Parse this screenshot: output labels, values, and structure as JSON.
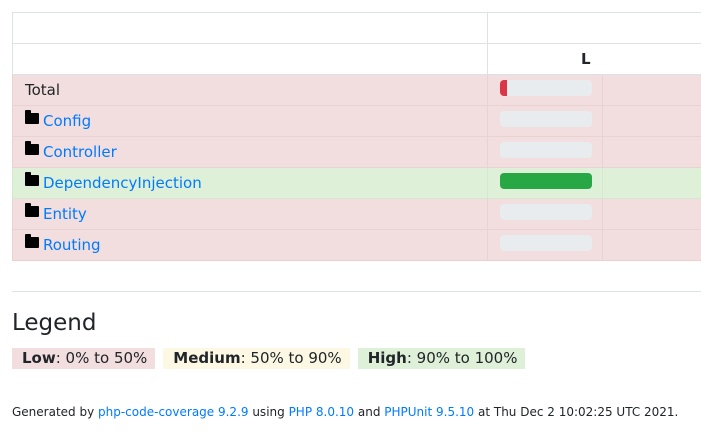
{
  "table": {
    "header_fragment": "L",
    "rows": [
      {
        "name": "Total",
        "type": "total",
        "level": "low",
        "coverage_percent": 8
      },
      {
        "name": "Config",
        "type": "directory",
        "level": "low",
        "coverage_percent": 0
      },
      {
        "name": "Controller",
        "type": "directory",
        "level": "low",
        "coverage_percent": 0
      },
      {
        "name": "DependencyInjection",
        "type": "directory",
        "level": "high",
        "coverage_percent": 100
      },
      {
        "name": "Entity",
        "type": "directory",
        "level": "low",
        "coverage_percent": 0
      },
      {
        "name": "Routing",
        "type": "directory",
        "level": "low",
        "coverage_percent": 0
      }
    ]
  },
  "legend": {
    "title": "Legend",
    "low": {
      "label": "Low",
      "range": ": 0% to 50%"
    },
    "medium": {
      "label": "Medium",
      "range": ": 50% to 90%"
    },
    "high": {
      "label": "High",
      "range": ": 90% to 100%"
    }
  },
  "footer": {
    "generated_by": "Generated by ",
    "tool_link": "php-code-coverage 9.2.9",
    "using": " using ",
    "php_link": "PHP 8.0.10",
    "and": " and ",
    "phpunit_link": "PHPUnit 9.5.10",
    "date": " at Thu Dec 2 10:02:25 UTC 2021."
  },
  "colors": {
    "low_bg": "#f2dede",
    "medium_bg": "#fcf8e3",
    "high_bg": "#dff0d8",
    "bar_danger": "#dc3545",
    "bar_success": "#28a745",
    "link": "#007bff"
  },
  "icons": {
    "directory": "folder-icon"
  }
}
